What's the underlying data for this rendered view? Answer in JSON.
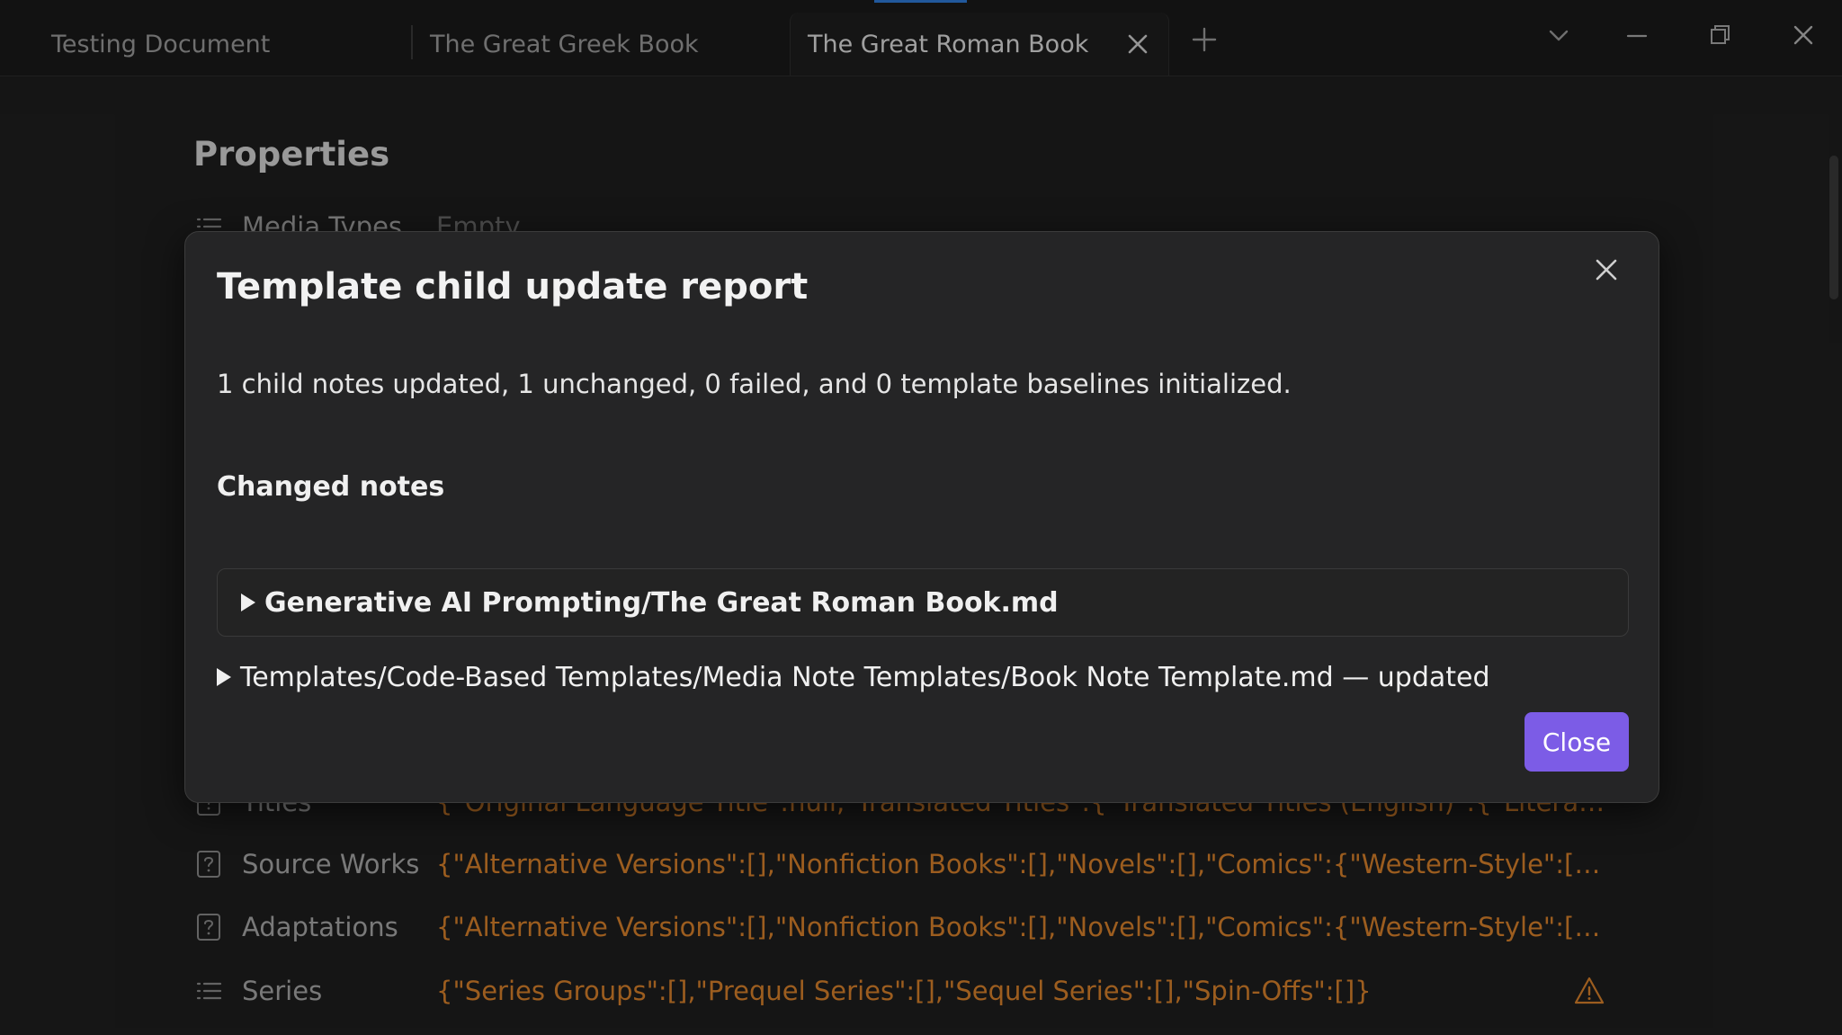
{
  "tabs": [
    {
      "label": "Testing Document",
      "active": false
    },
    {
      "label": "The Great Greek Book",
      "active": false
    },
    {
      "label": "The Great Roman Book",
      "active": true
    }
  ],
  "icons": {
    "tab_close": "close-icon",
    "new_tab": "plus-icon",
    "tab_list": "chevron-down-icon",
    "minimize": "minimize-icon",
    "restore": "restore-icon",
    "window_close": "close-icon",
    "warning": "warning-icon"
  },
  "document": {
    "properties_heading": "Properties",
    "properties": [
      {
        "icon": "list-icon",
        "name": "Media Types",
        "value": "Empty",
        "empty": true
      },
      {
        "icon": "unknown-type-icon",
        "name": "Titles",
        "value": "{\"Original Language Title\":null,\"Translated Titles\":{\"Translated Titles (English)\":{\"Literally Translated Ti..."
      },
      {
        "icon": "unknown-type-icon",
        "name": "Source Works",
        "value": "{\"Alternative Versions\":[],\"Nonfiction Books\":[],\"Novels\":[],\"Comics\":{\"Western-Style\":[],\"Manga\":[]},\"A..."
      },
      {
        "icon": "unknown-type-icon",
        "name": "Adaptations",
        "value": "{\"Alternative Versions\":[],\"Nonfiction Books\":[],\"Novels\":[],\"Comics\":{\"Western-Style\":[],\"Manga\":[]},\"A..."
      },
      {
        "icon": "list-icon",
        "name": "Series",
        "value": "{\"Series Groups\":[],\"Prequel Series\":[],\"Sequel Series\":[],\"Spin-Offs\":[]}",
        "warning": true
      }
    ]
  },
  "modal": {
    "title": "Template child update report",
    "summary": "1 child notes updated, 1 unchanged, 0 failed, and 0 template baselines initialized.",
    "changed_heading": "Changed notes",
    "changed_items": [
      {
        "label": "Generative AI Prompting/The Great Roman Book.md"
      },
      {
        "label": "Templates/Code-Based Templates/Media Note Templates/Book Note Template.md — updated"
      }
    ],
    "close_label": "Close"
  },
  "colors": {
    "accent": "#7c5ce6",
    "property_value": "#d9822b",
    "background": "#1e1e1e"
  }
}
